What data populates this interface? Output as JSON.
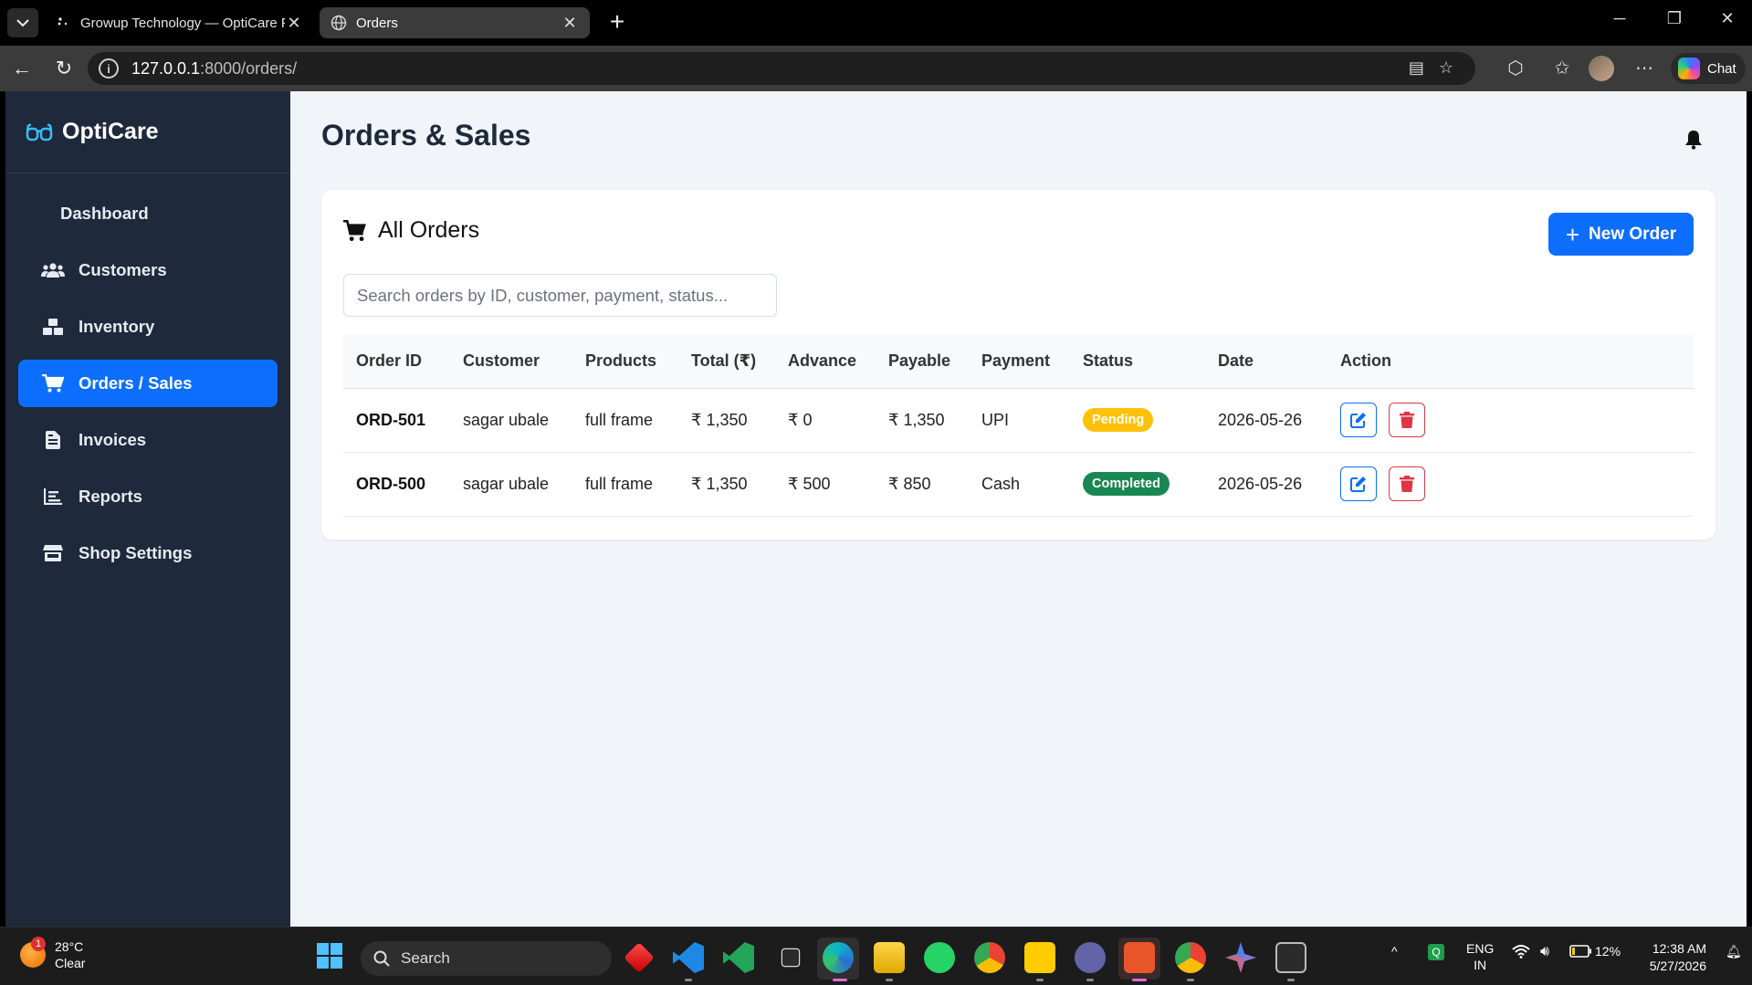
{
  "browser": {
    "tabs": [
      {
        "title": "Growup Technology — OptiCare P",
        "active": false
      },
      {
        "title": "Orders",
        "active": true
      }
    ],
    "url_host": "127.0.0.1",
    "url_path": ":8000/orders/",
    "chat_label": "Chat"
  },
  "sidebar": {
    "brand": "OptiCare",
    "items": [
      {
        "label": "Dashboard",
        "icon": "none"
      },
      {
        "label": "Customers",
        "icon": "users-icon"
      },
      {
        "label": "Inventory",
        "icon": "boxes-icon"
      },
      {
        "label": "Orders / Sales",
        "icon": "cart-icon",
        "active": true
      },
      {
        "label": "Invoices",
        "icon": "file-invoice-icon"
      },
      {
        "label": "Reports",
        "icon": "chart-icon"
      },
      {
        "label": "Shop Settings",
        "icon": "store-icon"
      }
    ]
  },
  "main": {
    "page_title": "Orders & Sales",
    "card_title": "All Orders",
    "new_order_label": "New Order",
    "search_placeholder": "Search orders by ID, customer, payment, status...",
    "table": {
      "headers": [
        "Order ID",
        "Customer",
        "Products",
        "Total (₹)",
        "Advance",
        "Payable",
        "Payment",
        "Status",
        "Date",
        "Action"
      ],
      "rows": [
        {
          "order_id": "ORD-501",
          "customer": "sagar ubale",
          "products": "full frame",
          "total": "₹ 1,350",
          "advance": "₹ 0",
          "payable": "₹ 1,350",
          "payment": "UPI",
          "status": "Pending",
          "date": "2026-05-26"
        },
        {
          "order_id": "ORD-500",
          "customer": "sagar ubale",
          "products": "full frame",
          "total": "₹ 1,350",
          "advance": "₹ 500",
          "payable": "₹ 850",
          "payment": "Cash",
          "status": "Completed",
          "date": "2026-05-26"
        }
      ]
    }
  },
  "colors": {
    "primary": "#0d6efd",
    "sidebar_bg": "#1e293b",
    "pending": "#ffc107",
    "completed": "#198754",
    "danger": "#dc3545"
  },
  "taskbar": {
    "weather_temp": "28°C",
    "weather_desc": "Clear",
    "weather_badge": "1",
    "search_label": "Search",
    "lang_top": "ENG",
    "lang_bottom": "IN",
    "battery": "12%",
    "time": "12:38 AM",
    "date": "5/27/2026"
  }
}
